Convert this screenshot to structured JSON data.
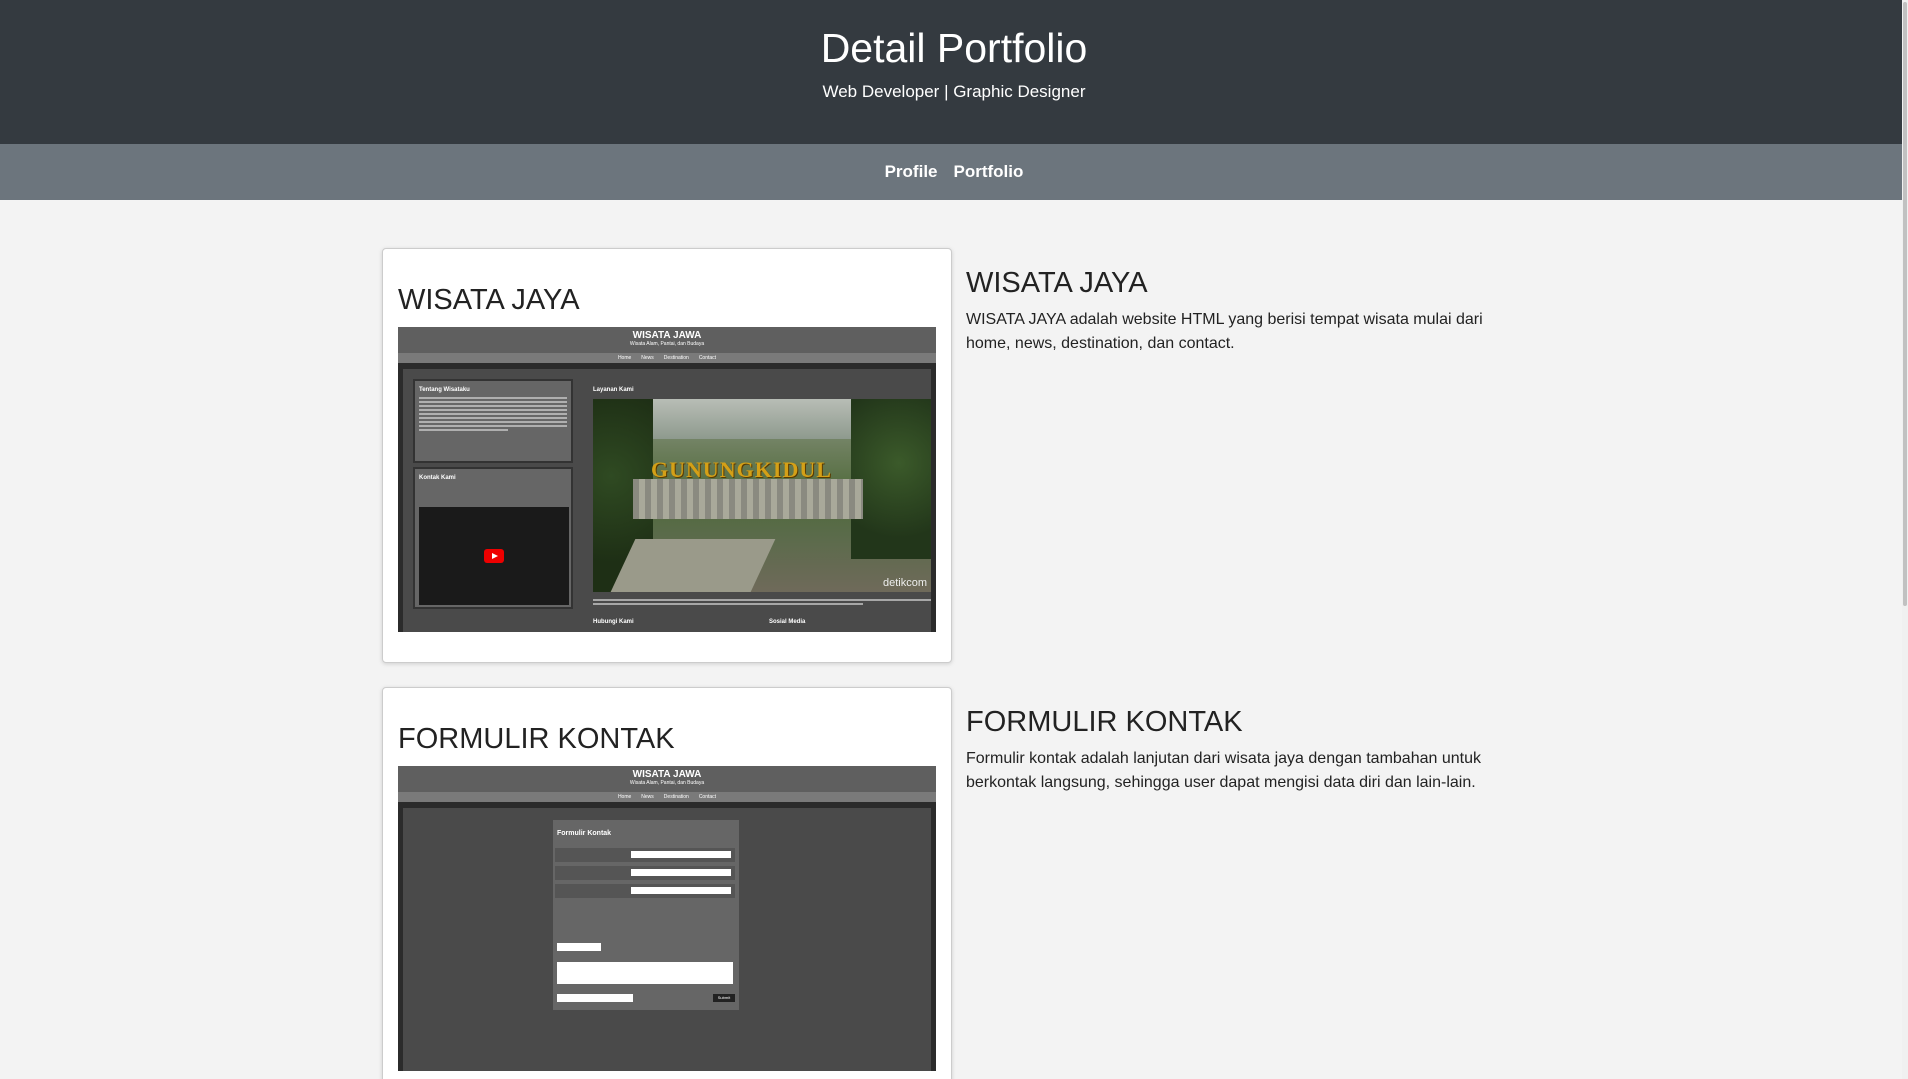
{
  "header": {
    "title": "Detail Portfolio",
    "subtitle": "Web Developer | Graphic Designer"
  },
  "nav": {
    "items": [
      {
        "label": "Profile"
      },
      {
        "label": "Portfolio"
      }
    ]
  },
  "portfolio": [
    {
      "card_title": "WISATA JAYA",
      "title": "WISATA JAYA",
      "description": "WISATA JAYA adalah website HTML yang berisi tempat wisata mulai dari home, news, destination, dan contact.",
      "screenshot": {
        "site_title": "WISATA JAWA",
        "site_subtitle": "Wisata Alam, Pantai, dan Budaya",
        "nav": [
          "Home",
          "News",
          "Destination",
          "Contact"
        ],
        "about_title": "Tentang Wisataku",
        "contact_title": "Kontak Kami",
        "services_title": "Layanan Kami",
        "photo_sign": "GUNUNGKIDUL",
        "photo_watermark": "detikcom",
        "reach_title": "Hubungi Kami",
        "social_title": "Sosial Media"
      }
    },
    {
      "card_title": "FORMULIR KONTAK",
      "title": "FORMULIR KONTAK",
      "description": "Formulir kontak adalah lanjutan dari wisata jaya dengan tambahan untuk berkontak langsung, sehingga user dapat mengisi data diri dan lain-lain.",
      "screenshot": {
        "site_title": "WISATA JAWA",
        "site_subtitle": "Wisata Alam, Pantai, dan Budaya",
        "nav": [
          "Home",
          "News",
          "Destination",
          "Contact"
        ],
        "form_title": "Formulir Kontak",
        "submit": "Submit"
      }
    }
  ]
}
